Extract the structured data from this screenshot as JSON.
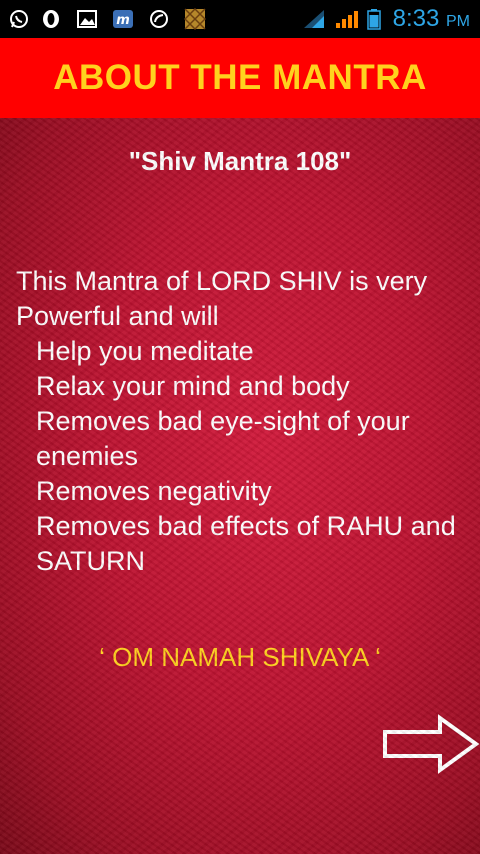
{
  "status_bar": {
    "time": "8:33",
    "ampm": "PM",
    "icons": [
      "whatsapp-icon",
      "opera-icon",
      "gallery-icon",
      "m-app-icon",
      "sync-icon",
      "pattern-app-icon",
      "wifi-icon",
      "signal-icon",
      "battery-icon"
    ]
  },
  "header": {
    "title": "ABOUT THE MANTRA"
  },
  "content": {
    "mantra_name": "\"Shiv Mantra 108\"",
    "intro": "This Mantra of LORD SHIV is very Powerful and will",
    "benefits": [
      "Help you meditate",
      "Relax your mind and body",
      "Removes bad eye-sight of your enemies",
      "Removes negativity",
      "Removes bad effects of RAHU and SATURN"
    ],
    "chant": "‘ OM NAMAH SHIVAYA ‘"
  },
  "colors": {
    "header_bg": "#ff0000",
    "title_text": "#ffd21e",
    "clock": "#2ea6e6"
  }
}
